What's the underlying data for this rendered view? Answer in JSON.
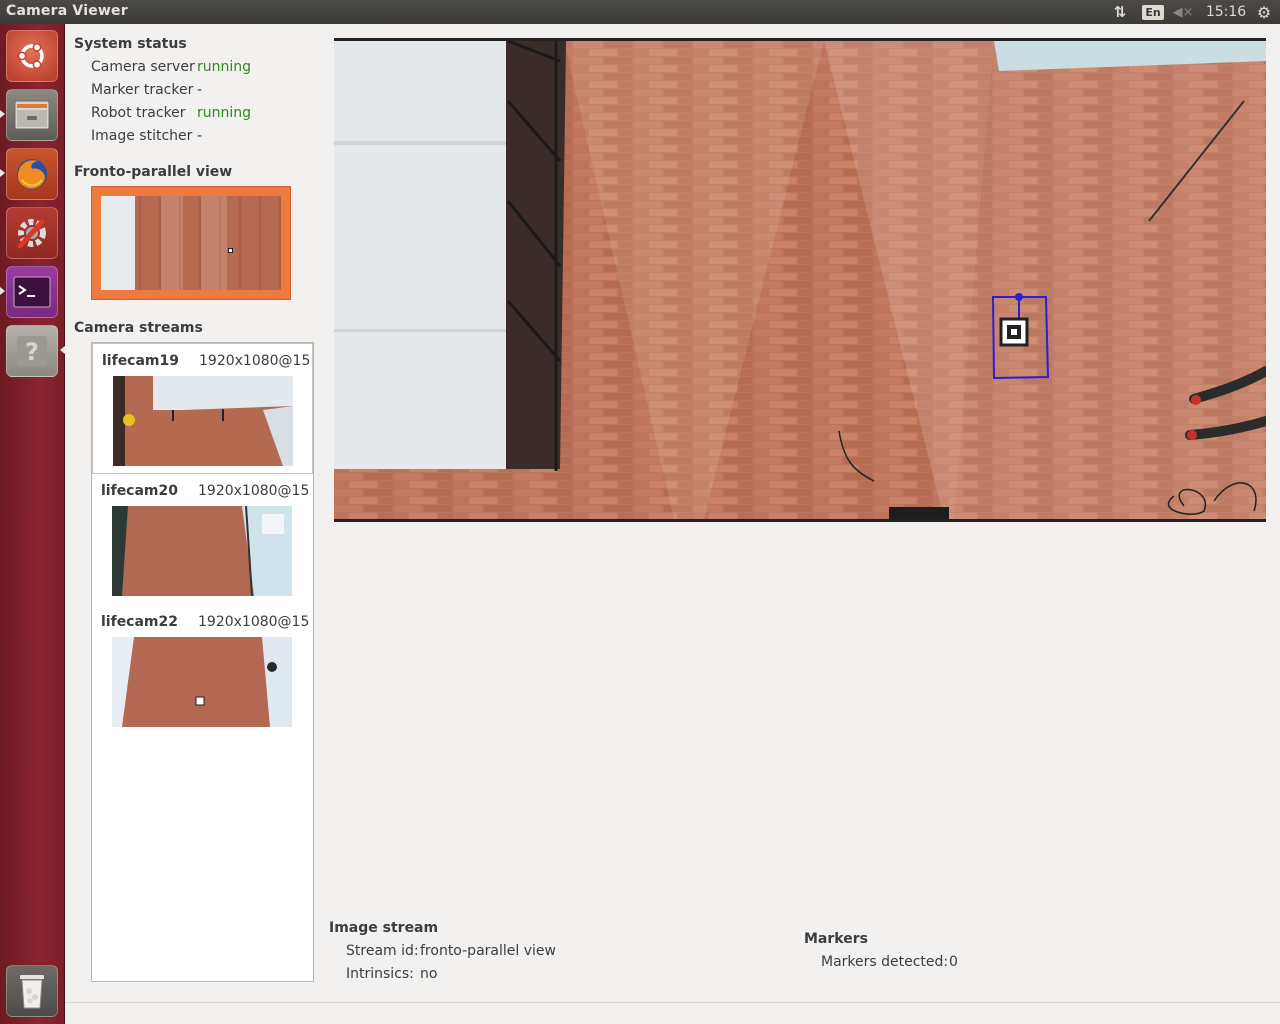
{
  "window": {
    "title": "Camera Viewer"
  },
  "top_panel": {
    "network_icon": "network-updown-icon",
    "language": "En",
    "volume_icon": "volume-muted-icon",
    "clock": "15:16",
    "power_icon": "gear-power-icon"
  },
  "launcher": {
    "items": [
      {
        "name": "ubuntu-dash-icon"
      },
      {
        "name": "file-manager-icon"
      },
      {
        "name": "firefox-icon"
      },
      {
        "name": "system-settings-icon"
      },
      {
        "name": "terminal-icon"
      },
      {
        "name": "help-icon"
      },
      {
        "name": "trash-icon"
      }
    ]
  },
  "system_status": {
    "title": "System status",
    "rows": [
      {
        "label": "Camera server",
        "value": "running",
        "state": "running"
      },
      {
        "label": "Marker tracker",
        "value": "-",
        "state": "none"
      },
      {
        "label": "Robot tracker",
        "value": "running",
        "state": "running"
      },
      {
        "label": "Image stitcher",
        "value": "-",
        "state": "none"
      }
    ]
  },
  "fronto": {
    "title": "Fronto-parallel view"
  },
  "camera_streams": {
    "title": "Camera streams",
    "items": [
      {
        "name": "lifecam19",
        "resolution": "1920x1080@15",
        "selected": true
      },
      {
        "name": "lifecam20",
        "resolution": "1920x1080@15",
        "selected": false
      },
      {
        "name": "lifecam22",
        "resolution": "1920x1080@15",
        "selected": false
      }
    ]
  },
  "image_stream": {
    "title": "Image stream",
    "stream_id_label": "Stream id:",
    "stream_id_value": "fronto-parallel view",
    "intrinsics_label": "Intrinsics:",
    "intrinsics_value": "no"
  },
  "markers": {
    "title": "Markers",
    "detected_label": "Markers detected:",
    "detected_value": "0"
  },
  "colors": {
    "launcher": "#7a1f29",
    "running": "#2b8a1b",
    "thumb_frame": "#ee7a3f",
    "marker_box": "#2a1fd6"
  }
}
